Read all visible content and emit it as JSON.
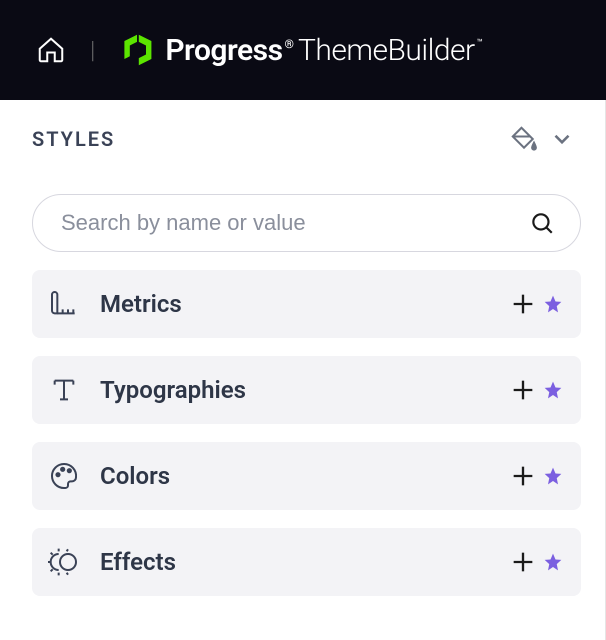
{
  "header": {
    "brand_progress": "Progress",
    "brand_reg": "®",
    "brand_theme": "ThemeBuilder",
    "brand_tm": "™"
  },
  "panel": {
    "title": "STYLES",
    "search_placeholder": "Search by name or value"
  },
  "categories": [
    {
      "id": "metrics",
      "label": "Metrics"
    },
    {
      "id": "typographies",
      "label": "Typographies"
    },
    {
      "id": "colors",
      "label": "Colors"
    },
    {
      "id": "effects",
      "label": "Effects"
    }
  ]
}
